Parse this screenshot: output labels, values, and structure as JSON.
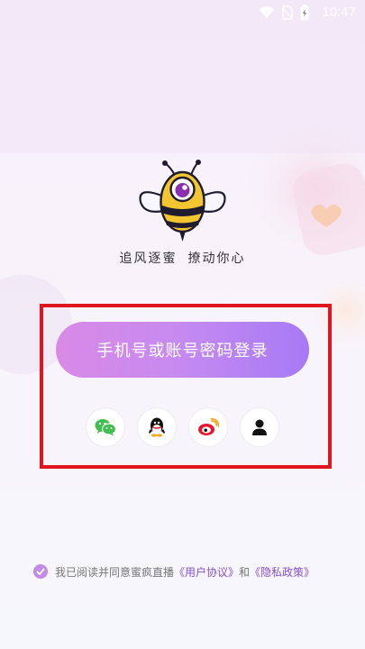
{
  "status_bar": {
    "time": "10:47"
  },
  "slogan": {
    "part1": "追风逐蜜",
    "part2": "撩动你心"
  },
  "login": {
    "primary_button": "手机号或账号密码登录"
  },
  "social_login": [
    {
      "name": "wechat",
      "icon": "wechat-icon",
      "color": "#3fbf4f"
    },
    {
      "name": "qq",
      "icon": "qq-penguin-icon",
      "color": "#111111"
    },
    {
      "name": "weibo",
      "icon": "weibo-icon",
      "color": "#e6162d"
    },
    {
      "name": "account",
      "icon": "user-icon",
      "color": "#111111"
    }
  ],
  "agreement": {
    "text": "我已阅读并同意蜜疯直播",
    "user_agreement": "《用户协议》",
    "conjunction": "和",
    "privacy_policy": "《隐私政策》"
  },
  "colors": {
    "accent_start": "#d98ae6",
    "accent_end": "#a67af5",
    "highlight": "#e0151d",
    "link": "#8a4fc7"
  }
}
